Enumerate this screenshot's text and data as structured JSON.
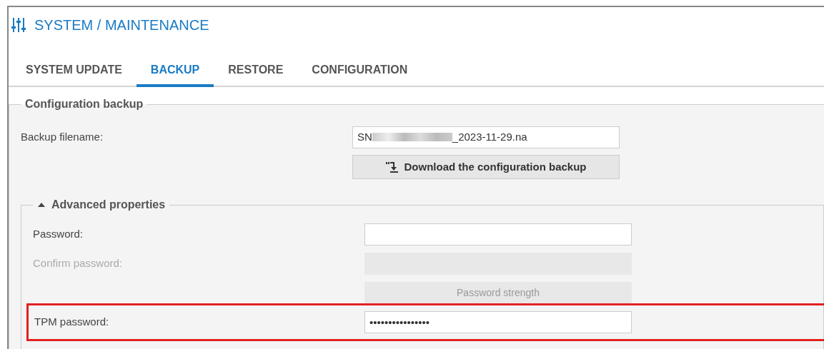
{
  "header": {
    "title": "SYSTEM / MAINTENANCE"
  },
  "tabs": [
    {
      "label": "SYSTEM UPDATE",
      "selected": false
    },
    {
      "label": "BACKUP",
      "selected": true
    },
    {
      "label": "RESTORE",
      "selected": false
    },
    {
      "label": "CONFIGURATION",
      "selected": false
    }
  ],
  "backup_section": {
    "legend": "Configuration backup",
    "filename": {
      "label": "Backup filename:",
      "value_start": "SN",
      "value_end": "_2023-11-29.na",
      "redacted": true
    },
    "download_button": "Download the configuration backup",
    "advanced": {
      "legend": "Advanced properties",
      "expanded": true,
      "fields": [
        {
          "kind": "field",
          "label": "Password:",
          "disabled": false,
          "highlighted": false
        },
        {
          "kind": "field",
          "label": "Confirm password:",
          "disabled": true,
          "highlighted": false
        },
        {
          "kind": "strength",
          "label": "Password strength"
        },
        {
          "kind": "field",
          "label": "TPM password:",
          "value": "••••••••••••••••",
          "disabled": false,
          "highlighted": true
        }
      ]
    }
  }
}
